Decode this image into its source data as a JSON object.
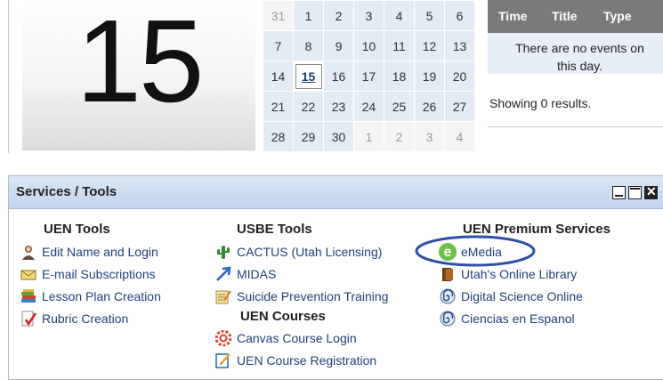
{
  "calendar": {
    "big_day": "15",
    "weeks": [
      [
        "31",
        "1",
        "2",
        "3",
        "4",
        "5",
        "6"
      ],
      [
        "7",
        "8",
        "9",
        "10",
        "11",
        "12",
        "13"
      ],
      [
        "14",
        "15",
        "16",
        "17",
        "18",
        "19",
        "20"
      ],
      [
        "21",
        "22",
        "23",
        "24",
        "25",
        "26",
        "27"
      ],
      [
        "28",
        "29",
        "30",
        "1",
        "2",
        "3",
        "4"
      ]
    ],
    "selected": "15"
  },
  "events": {
    "columns": [
      "Time",
      "Title",
      "Type"
    ],
    "empty_message": "There are no events on this day.",
    "result_count": "Showing 0 results."
  },
  "services": {
    "title": "Services / Tools",
    "columns": [
      {
        "heading": "UEN Tools",
        "items": [
          {
            "label": "Edit Name and Login",
            "icon": "person-icon"
          },
          {
            "label": "E-mail Subscriptions",
            "icon": "envelope-icon"
          },
          {
            "label": "Lesson Plan Creation",
            "icon": "books-icon"
          },
          {
            "label": "Rubric Creation",
            "icon": "rubric-icon"
          }
        ]
      },
      {
        "heading": "USBE Tools",
        "items": [
          {
            "label": "CACTUS (Utah Licensing)",
            "icon": "cactus-icon"
          },
          {
            "label": "MIDAS",
            "icon": "arrow-icon"
          },
          {
            "label": "Suicide Prevention Training",
            "icon": "notepad-icon"
          }
        ],
        "subheading": "UEN Courses",
        "sub_items": [
          {
            "label": "Canvas Course Login",
            "icon": "canvas-icon"
          },
          {
            "label": "UEN Course Registration",
            "icon": "registration-icon"
          }
        ]
      },
      {
        "heading": "UEN Premium Services",
        "items": [
          {
            "label": "eMedia",
            "icon": "emedia-icon"
          },
          {
            "label": "Utah's Online Library",
            "icon": "library-icon"
          },
          {
            "label": "Digital Science Online",
            "icon": "spiral-icon"
          },
          {
            "label": "Ciencias en Espanol",
            "icon": "spiral-icon"
          }
        ]
      }
    ]
  },
  "colors": {
    "link": "#1f3f7a",
    "highlight_ellipse": "#2c4fa5",
    "header_bg": "#7a7a7a"
  }
}
